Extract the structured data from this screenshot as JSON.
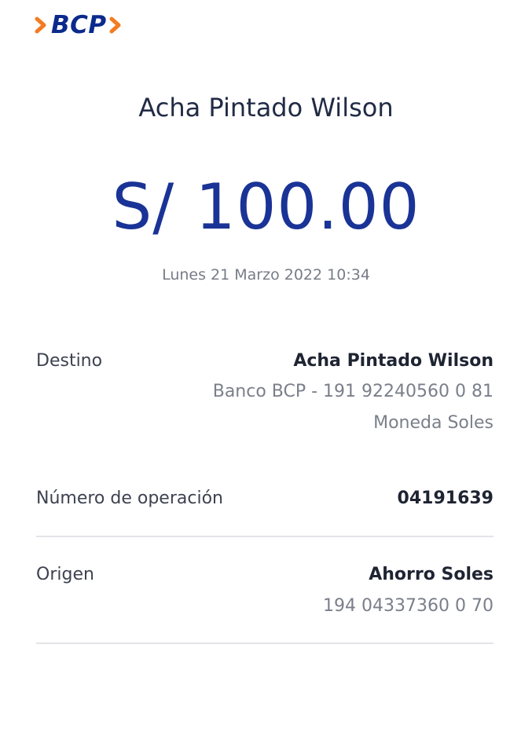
{
  "brand": {
    "logo_text": "BCP",
    "accent_color": "#f47b20",
    "primary_color": "#0b2a8c"
  },
  "transfer": {
    "recipient_name": "Acha Pintado Wilson",
    "amount": "S/ 100.00",
    "datetime": "Lunes 21 Marzo 2022 10:34"
  },
  "details": {
    "destino": {
      "label": "Destino",
      "name": "Acha Pintado Wilson",
      "account": "Banco BCP - 191 92240560 0 81",
      "currency": "Moneda Soles"
    },
    "operacion": {
      "label": "Número de operación",
      "value": "04191639"
    },
    "origen": {
      "label": "Origen",
      "account_type": "Ahorro Soles",
      "account_number": "194 04337360 0 70"
    }
  }
}
